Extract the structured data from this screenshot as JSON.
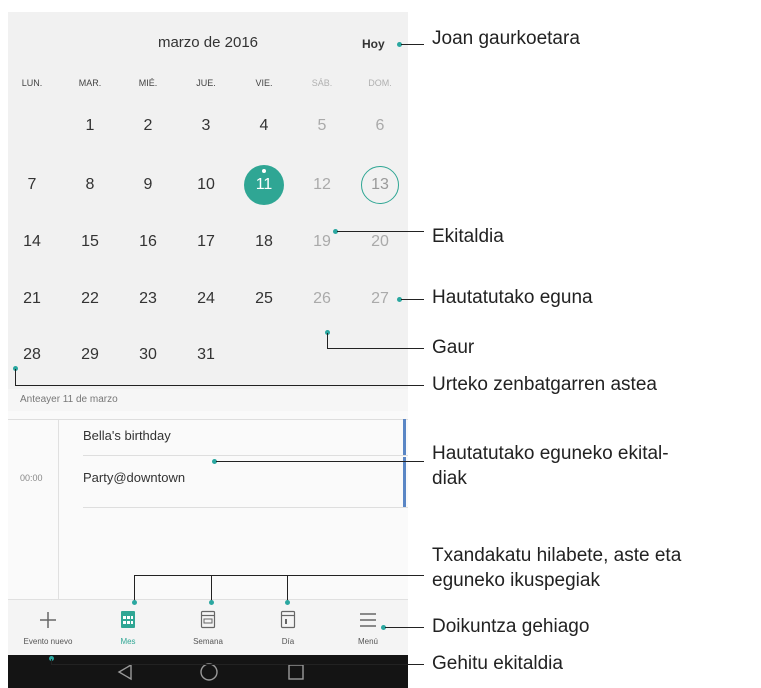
{
  "calendar": {
    "month_title": "marzo de 2016",
    "today_label": "Hoy",
    "weekdays": [
      "LUN.",
      "MAR.",
      "MIÉ.",
      "JUE.",
      "VIE.",
      "SÁB.",
      "DOM."
    ],
    "weeks": [
      [
        "",
        "1",
        "2",
        "3",
        "4",
        "5",
        "6"
      ],
      [
        "7",
        "8",
        "9",
        "10",
        "11",
        "12",
        "13"
      ],
      [
        "14",
        "15",
        "16",
        "17",
        "18",
        "19",
        "20"
      ],
      [
        "21",
        "22",
        "23",
        "24",
        "25",
        "26",
        "27"
      ],
      [
        "28",
        "29",
        "30",
        "31",
        "",
        "",
        ""
      ]
    ],
    "selected_day": "11",
    "today_day": "13"
  },
  "events": {
    "header": "Anteayer 11 de marzo",
    "items": [
      {
        "title": "Bella's birthday",
        "time": ""
      },
      {
        "title": "Party@downtown",
        "time": "00:00"
      }
    ]
  },
  "bottom_bar": {
    "tabs": [
      "Evento nuevo",
      "Mes",
      "Semana",
      "Día",
      "Menú"
    ]
  },
  "annotations": {
    "joan": "Joan gaurkoetara",
    "ekitaldia": "Ekitaldia",
    "hautatutako": "Hautatutako eguna",
    "gaur": "Gaur",
    "urteko": "Urteko zenbatgarren astea",
    "eguneko_1": "Hautatutako eguneko ekital-",
    "eguneko_2": "diak",
    "txandakatu_1": "Txandakatu hilabete, aste eta",
    "txandakatu_2": "eguneko ikuspegiak",
    "doikuntza": "Doikuntza gehiago",
    "gehitu": "Gehitu ekitaldia"
  },
  "colors": {
    "accent": "#2fa694",
    "event_bar": "#5a86c5",
    "annotation_dot": "#2aa7a0"
  }
}
